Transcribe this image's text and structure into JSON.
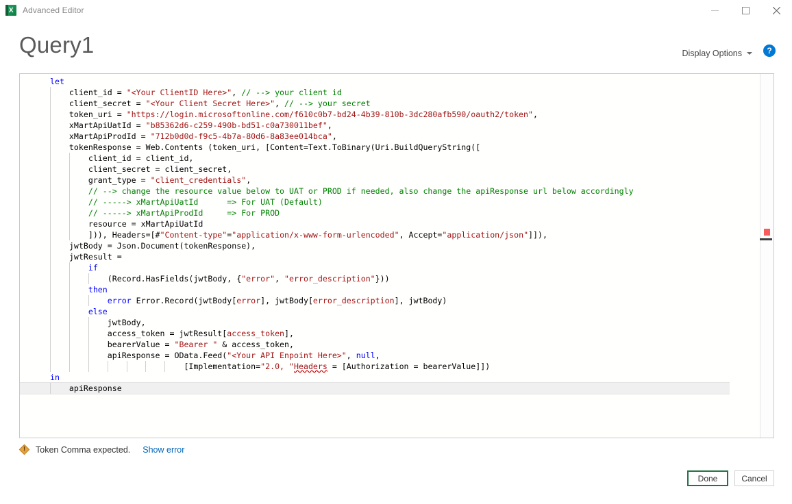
{
  "window": {
    "app_icon": "excel-icon",
    "title": "Advanced Editor",
    "controls": {
      "minimize": "minimize-icon",
      "maximize": "maximize-icon",
      "close": "close-icon"
    }
  },
  "header": {
    "page_title": "Query1",
    "display_options_label": "Display Options",
    "help_label": "?"
  },
  "editor": {
    "lines": [
      {
        "indent": 0,
        "tokens": [
          {
            "t": "let",
            "c": "kw"
          }
        ]
      },
      {
        "indent": 1,
        "tokens": [
          {
            "t": "client_id = "
          },
          {
            "t": "\"<Your ClientID Here>\"",
            "c": "str"
          },
          {
            "t": ", "
          },
          {
            "t": "// --> your client id",
            "c": "cmt"
          }
        ]
      },
      {
        "indent": 1,
        "tokens": [
          {
            "t": "client_secret = "
          },
          {
            "t": "\"<Your Client Secret Here>\"",
            "c": "str"
          },
          {
            "t": ", "
          },
          {
            "t": "// --> your secret",
            "c": "cmt"
          }
        ]
      },
      {
        "indent": 1,
        "tokens": [
          {
            "t": "token_uri = "
          },
          {
            "t": "\"https://login.microsoftonline.com/f610c0b7-bd24-4b39-810b-3dc280afb590/oauth2/token\"",
            "c": "str"
          },
          {
            "t": ","
          }
        ]
      },
      {
        "indent": 1,
        "tokens": [
          {
            "t": "xMartApiUatId = "
          },
          {
            "t": "\"b85362d6-c259-490b-bd51-c0a730011bef\"",
            "c": "str"
          },
          {
            "t": ","
          }
        ]
      },
      {
        "indent": 1,
        "tokens": [
          {
            "t": "xMartApiProdId = "
          },
          {
            "t": "\"712b0d0d-f9c5-4b7a-80d6-8a83ee014bca\"",
            "c": "str"
          },
          {
            "t": ","
          }
        ]
      },
      {
        "indent": 1,
        "tokens": [
          {
            "t": "tokenResponse = Web.Contents (token_uri, [Content=Text.ToBinary(Uri.BuildQueryString(["
          }
        ]
      },
      {
        "indent": 2,
        "tokens": [
          {
            "t": "client_id = client_id,"
          }
        ]
      },
      {
        "indent": 2,
        "tokens": [
          {
            "t": "client_secret = client_secret,"
          }
        ]
      },
      {
        "indent": 2,
        "tokens": [
          {
            "t": "grant_type = "
          },
          {
            "t": "\"client_credentials\"",
            "c": "str"
          },
          {
            "t": ","
          }
        ]
      },
      {
        "indent": 2,
        "tokens": [
          {
            "t": "// --> change the resource value below to UAT or PROD if needed, also change the apiResponse url below accordingly",
            "c": "cmt"
          }
        ]
      },
      {
        "indent": 2,
        "tokens": [
          {
            "t": "// -----> xMartApiUatId      => For UAT (Default)",
            "c": "cmt"
          }
        ]
      },
      {
        "indent": 2,
        "tokens": [
          {
            "t": "// -----> xMartApiProdId     => For PROD",
            "c": "cmt"
          }
        ]
      },
      {
        "indent": 2,
        "tokens": [
          {
            "t": "resource = xMartApiUatId"
          }
        ]
      },
      {
        "indent": 2,
        "tokens": [
          {
            "t": "])), Headers=[#"
          },
          {
            "t": "\"Content-type\"",
            "c": "str"
          },
          {
            "t": "="
          },
          {
            "t": "\"application/x-www-form-urlencoded\"",
            "c": "str"
          },
          {
            "t": ", Accept="
          },
          {
            "t": "\"application/json\"",
            "c": "str"
          },
          {
            "t": "]]),"
          }
        ]
      },
      {
        "indent": 1,
        "tokens": [
          {
            "t": "jwtBody = Json.Document(tokenResponse),"
          }
        ]
      },
      {
        "indent": 1,
        "tokens": [
          {
            "t": "jwtResult ="
          }
        ]
      },
      {
        "indent": 2,
        "tokens": [
          {
            "t": "if",
            "c": "kw"
          }
        ]
      },
      {
        "indent": 3,
        "tokens": [
          {
            "t": "(Record.HasFields(jwtBody, {"
          },
          {
            "t": "\"error\"",
            "c": "str"
          },
          {
            "t": ", "
          },
          {
            "t": "\"error_description\"",
            "c": "str"
          },
          {
            "t": "}))"
          }
        ]
      },
      {
        "indent": 2,
        "tokens": [
          {
            "t": "then",
            "c": "kw"
          }
        ]
      },
      {
        "indent": 3,
        "tokens": [
          {
            "t": "error",
            "c": "kw"
          },
          {
            "t": " Error.Record(jwtBody["
          },
          {
            "t": "error",
            "c": "str"
          },
          {
            "t": "], jwtBody["
          },
          {
            "t": "error_description",
            "c": "str"
          },
          {
            "t": "], jwtBody)"
          }
        ]
      },
      {
        "indent": 2,
        "tokens": [
          {
            "t": "else",
            "c": "kw"
          }
        ]
      },
      {
        "indent": 3,
        "tokens": [
          {
            "t": "jwtBody,"
          }
        ]
      },
      {
        "indent": 3,
        "tokens": [
          {
            "t": "access_token = jwtResult["
          },
          {
            "t": "access_token",
            "c": "str"
          },
          {
            "t": "],"
          }
        ]
      },
      {
        "indent": 3,
        "tokens": [
          {
            "t": "bearerValue = "
          },
          {
            "t": "\"Bearer \"",
            "c": "str"
          },
          {
            "t": " & access_token,"
          }
        ]
      },
      {
        "indent": 3,
        "tokens": [
          {
            "t": "apiResponse = OData.Feed("
          },
          {
            "t": "\"<Your API Enpoint Here>\"",
            "c": "str"
          },
          {
            "t": ", "
          },
          {
            "t": "null",
            "c": "kw"
          },
          {
            "t": ","
          }
        ]
      },
      {
        "indent": 7,
        "tokens": [
          {
            "t": "[Implementation="
          },
          {
            "t": "\"2.0, \"",
            "c": "str"
          },
          {
            "t": "Headers",
            "c": "err"
          },
          {
            "t": " = [Authorization = bearerValue]])"
          }
        ]
      },
      {
        "indent": 0,
        "tokens": [
          {
            "t": "in",
            "c": "kw"
          }
        ]
      },
      {
        "indent": 1,
        "current": true,
        "tokens": [
          {
            "t": "apiResponse"
          }
        ]
      }
    ]
  },
  "status": {
    "warn_icon": "warning-icon",
    "message": "Token Comma expected.",
    "show_error_link": "Show error"
  },
  "footer": {
    "done_label": "Done",
    "cancel_label": "Cancel"
  },
  "colors": {
    "accent_green": "#217346",
    "keyword_blue": "#0000ff",
    "string_red": "#a31515",
    "comment_green": "#008000",
    "link_blue": "#0066bb",
    "error_marker_red": "#fa5c5c",
    "help_blue": "#0078d4",
    "warning_amber": "#e8a33d"
  }
}
